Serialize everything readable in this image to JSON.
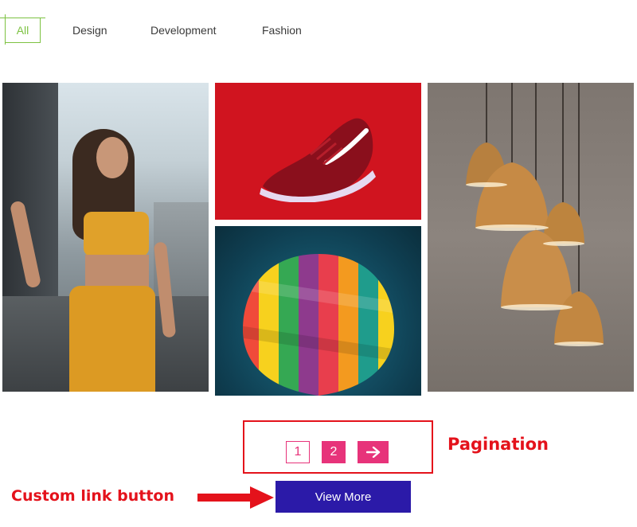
{
  "filters": {
    "items": [
      {
        "label": "All",
        "active": true
      },
      {
        "label": "Design",
        "active": false
      },
      {
        "label": "Development",
        "active": false
      },
      {
        "label": "Fashion",
        "active": false
      }
    ],
    "active_color": "#7dc242"
  },
  "gallery": {
    "items": [
      "woman-yellow-outfit",
      "red-sneaker",
      "hot-air-balloon",
      "pendant-lamps"
    ]
  },
  "pagination": {
    "pages": [
      "1",
      "2"
    ],
    "current": "2",
    "next_icon": "arrow-right-icon",
    "accent_color": "#e7337a"
  },
  "annotations": {
    "pagination_label": "Pagination",
    "custom_link_label": "Custom link button",
    "color": "#e4121b"
  },
  "cta": {
    "label": "View More",
    "color": "#2b1aa8"
  }
}
